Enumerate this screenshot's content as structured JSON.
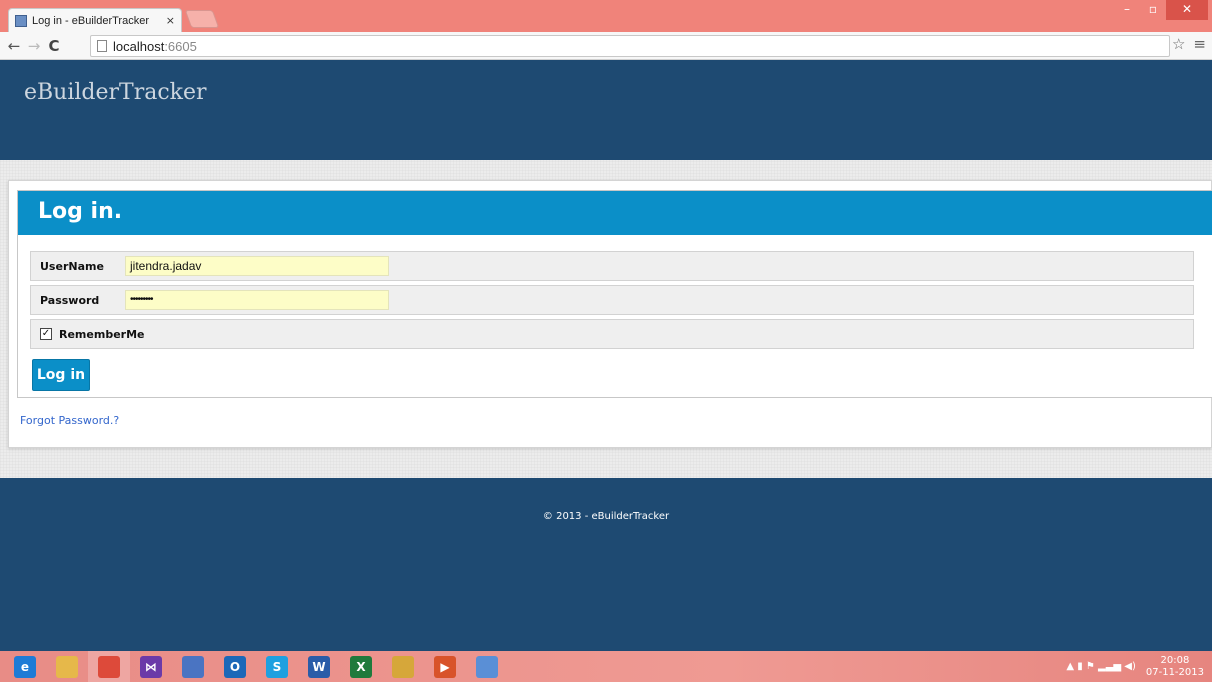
{
  "browser": {
    "tab_title": "Log in - eBuilderTracker",
    "tab_close": "×",
    "url_host": "localhost",
    "url_port": ":6605",
    "window_controls": {
      "minimize": "–",
      "maximize": "▫",
      "close": "✕"
    },
    "nav": {
      "back": "←",
      "forward": "→",
      "reload": "C"
    },
    "star": "☆",
    "menu": "≡"
  },
  "header": {
    "site_title": "eBuilderTracker"
  },
  "login": {
    "title": "Log in.",
    "username_label": "UserName",
    "username_value": "jitendra.jadav",
    "password_label": "Password",
    "password_value": "•••••••••",
    "remember_label": "RememberMe",
    "remember_check": "✓",
    "submit_label": "Log in",
    "forgot_link": "Forgot Password.?"
  },
  "footer": {
    "copyright": "© 2013 - eBuilderTracker"
  },
  "taskbar": {
    "apps": [
      {
        "name": "internet-explorer-icon",
        "glyph": "e",
        "color": "#1e7bd6"
      },
      {
        "name": "file-explorer-icon",
        "glyph": "",
        "color": "#e6b84a"
      },
      {
        "name": "chrome-icon",
        "glyph": "",
        "color": "#dd4a3a"
      },
      {
        "name": "visual-studio-icon",
        "glyph": "⋈",
        "color": "#6b3aa8"
      },
      {
        "name": "notepad-icon",
        "glyph": "",
        "color": "#4a74c2"
      },
      {
        "name": "outlook-icon",
        "glyph": "O",
        "color": "#1c68b8"
      },
      {
        "name": "skype-icon",
        "glyph": "S",
        "color": "#1ea0e0"
      },
      {
        "name": "word-icon",
        "glyph": "W",
        "color": "#2a5ca8"
      },
      {
        "name": "excel-icon",
        "glyph": "X",
        "color": "#1f7a3c"
      },
      {
        "name": "snipping-tool-icon",
        "glyph": "",
        "color": "#d6a73a"
      },
      {
        "name": "media-player-icon",
        "glyph": "▶",
        "color": "#d8532a"
      },
      {
        "name": "paint-icon",
        "glyph": "",
        "color": "#5a8fd6"
      }
    ],
    "tray_icons": "▲  ▮ ⚑ ▂▃▅ ◀)",
    "clock_time": "20:08",
    "clock_date": "07-11-2013"
  }
}
